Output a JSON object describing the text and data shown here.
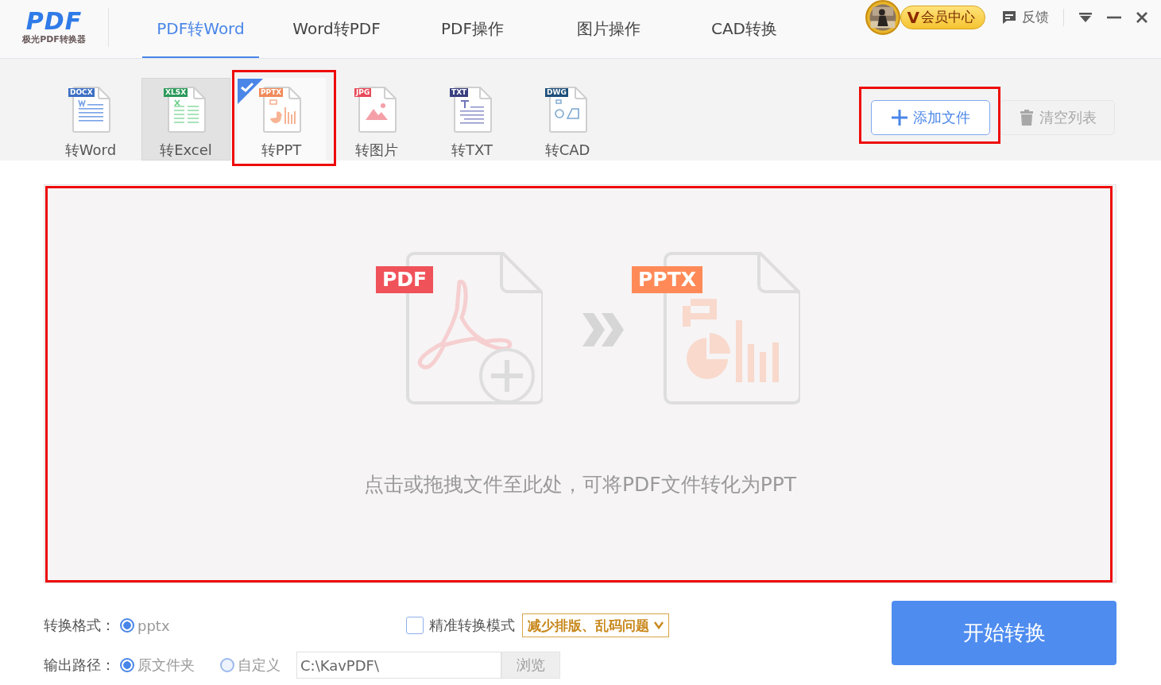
{
  "app": {
    "logo_mark": "PDF",
    "logo_caption": "极光PDF转换器"
  },
  "nav_tabs": [
    {
      "label": "PDF转Word",
      "selected": true
    },
    {
      "label": "Word转PDF",
      "selected": false
    },
    {
      "label": "PDF操作",
      "selected": false
    },
    {
      "label": "图片操作",
      "selected": false
    },
    {
      "label": "CAD转换",
      "selected": false
    }
  ],
  "member_button": {
    "badge": "V",
    "label": "会员中心"
  },
  "feedback": {
    "label": "反馈"
  },
  "tools": [
    {
      "kind": "word",
      "badge": "DOCX",
      "label": "转Word",
      "selected": false,
      "hovered": false,
      "highlighted": false
    },
    {
      "kind": "excel",
      "badge": "XLSX",
      "label": "转Excel",
      "selected": false,
      "hovered": true,
      "highlighted": false
    },
    {
      "kind": "ppt",
      "badge": "PPTX",
      "label": "转PPT",
      "selected": true,
      "hovered": false,
      "highlighted": true
    },
    {
      "badge": "JPG",
      "label": "转图片",
      "selected": false,
      "hovered": false,
      "highlighted": false
    },
    {
      "kind": "txt",
      "badge": "TXT",
      "label": "转TXT",
      "selected": false,
      "hovered": false,
      "highlighted": false
    },
    {
      "kind": "cad",
      "badge": "DWG",
      "label": "转CAD",
      "selected": false,
      "hovered": false,
      "highlighted": false
    }
  ],
  "add_button": {
    "label": "添加文件",
    "highlighted": true
  },
  "clear_button": {
    "label": "清空列表",
    "disabled": true
  },
  "drop_zone": {
    "source_badge": "PDF",
    "target_badge": "PPTX",
    "hint": "点击或拖拽文件至此处，可将PDF文件转化为PPT",
    "highlighted": true
  },
  "format": {
    "label": "转换格式：",
    "options": [
      {
        "label": "pptx",
        "selected": true
      }
    ]
  },
  "precise_mode": {
    "label": "精准转换模式",
    "checked": false,
    "tip": "减少排版、乱码问题"
  },
  "output": {
    "label": "输出路径：",
    "options": [
      {
        "label": "原文件夹",
        "selected": true
      },
      {
        "label": "自定义",
        "selected": false
      }
    ],
    "path": "C:\\KavPDF\\",
    "browse": {
      "label": "浏览",
      "disabled": true
    }
  },
  "start_button": {
    "label": "开始转换"
  }
}
